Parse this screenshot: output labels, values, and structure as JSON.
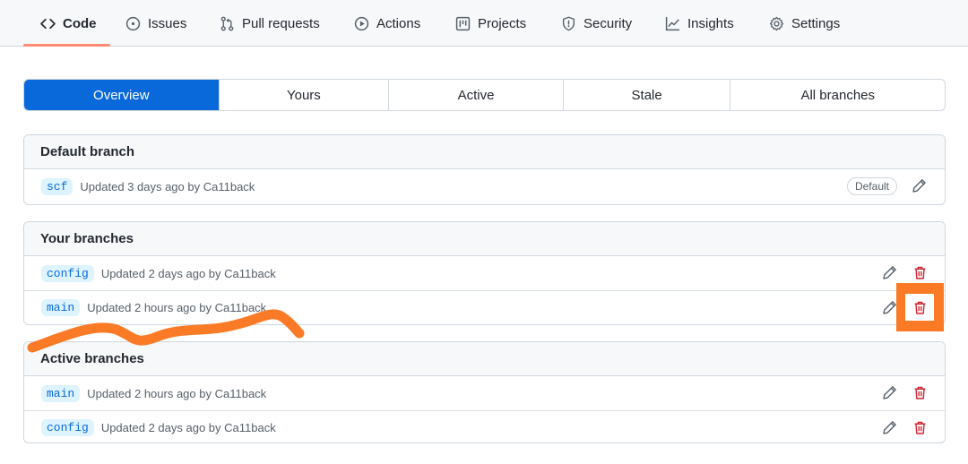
{
  "nav": {
    "tabs": [
      {
        "label": "Code",
        "icon": "code-icon"
      },
      {
        "label": "Issues",
        "icon": "issue-icon"
      },
      {
        "label": "Pull requests",
        "icon": "pull-request-icon"
      },
      {
        "label": "Actions",
        "icon": "play-icon"
      },
      {
        "label": "Projects",
        "icon": "project-icon"
      },
      {
        "label": "Security",
        "icon": "shield-icon"
      },
      {
        "label": "Insights",
        "icon": "graph-icon"
      },
      {
        "label": "Settings",
        "icon": "gear-icon"
      }
    ],
    "selected": "Code"
  },
  "subnav": {
    "items": [
      "Overview",
      "Yours",
      "Active",
      "Stale",
      "All branches"
    ],
    "selected": "Overview"
  },
  "sections": {
    "default": {
      "title": "Default branch",
      "rows": [
        {
          "branch": "scf",
          "meta": "Updated 3 days ago by Ca11back",
          "label": "Default"
        }
      ]
    },
    "yours": {
      "title": "Your branches",
      "rows": [
        {
          "branch": "config",
          "meta": "Updated 2 days ago by Ca11back"
        },
        {
          "branch": "main",
          "meta": "Updated 2 hours ago by Ca11back"
        }
      ]
    },
    "active": {
      "title": "Active branches",
      "rows": [
        {
          "branch": "main",
          "meta": "Updated 2 hours ago by Ca11back"
        },
        {
          "branch": "config",
          "meta": "Updated 2 days ago by Ca11back"
        }
      ]
    }
  },
  "colors": {
    "accent": "#0969da",
    "danger": "#cf222e",
    "annotation": "#fb7a26",
    "nav_underline": "#fd8c73"
  }
}
